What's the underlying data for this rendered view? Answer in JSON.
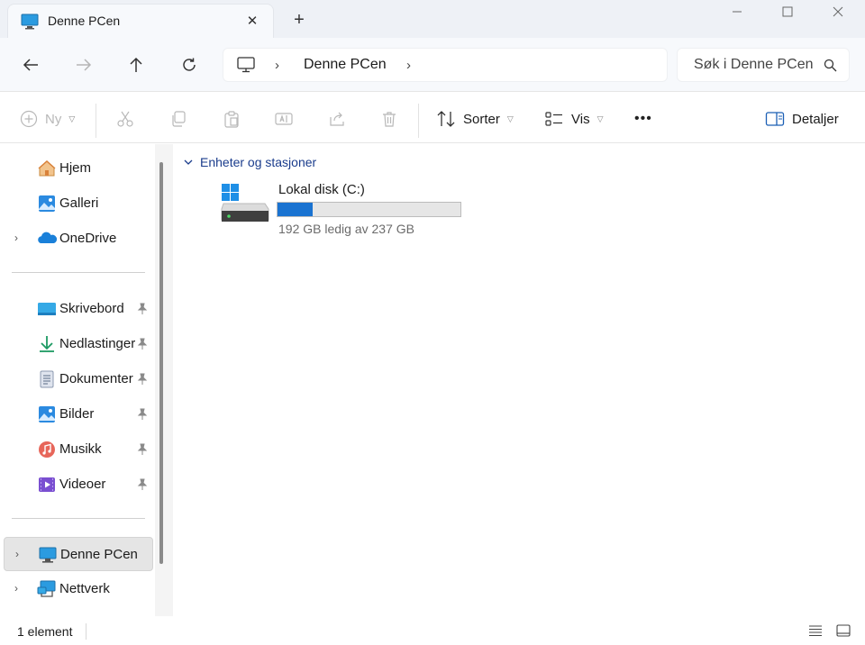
{
  "window": {
    "tab_title": "Denne PCen",
    "tab_close": "✕",
    "new_tab": "+"
  },
  "nav": {
    "address_crumbs": [
      "Denne PCen"
    ],
    "search_placeholder": "Søk i Denne PCen"
  },
  "commands": {
    "new_label": "Ny",
    "sort_label": "Sorter",
    "view_label": "Vis",
    "more_label": "•••",
    "details_label": "Detaljer"
  },
  "sidebar": {
    "top_items": [
      {
        "label": "Hjem",
        "icon": "home-icon",
        "expandable": false
      },
      {
        "label": "Galleri",
        "icon": "gallery-icon",
        "expandable": false
      },
      {
        "label": "OneDrive",
        "icon": "onedrive-icon",
        "expandable": true
      }
    ],
    "pinned_items": [
      {
        "label": "Skrivebord",
        "icon": "desktop-icon"
      },
      {
        "label": "Nedlastinger",
        "icon": "downloads-icon"
      },
      {
        "label": "Dokumenter",
        "icon": "documents-icon"
      },
      {
        "label": "Bilder",
        "icon": "pictures-icon"
      },
      {
        "label": "Musikk",
        "icon": "music-icon"
      },
      {
        "label": "Videoer",
        "icon": "videos-icon"
      }
    ],
    "bottom_items": [
      {
        "label": "Denne PCen",
        "icon": "this-pc-icon",
        "selected": true
      },
      {
        "label": "Nettverk",
        "icon": "network-icon",
        "selected": false
      }
    ]
  },
  "main": {
    "group_title": "Enheter og stasjoner",
    "drives": [
      {
        "name": "Lokal disk (C:)",
        "free_text": "192 GB ledig av 237 GB",
        "used_fraction": 0.19
      }
    ]
  },
  "status": {
    "item_count": "1 element"
  },
  "colors": {
    "accent": "#1a73d1",
    "group_header": "#1a3c8c",
    "selected_bg": "#e5e5e5"
  }
}
